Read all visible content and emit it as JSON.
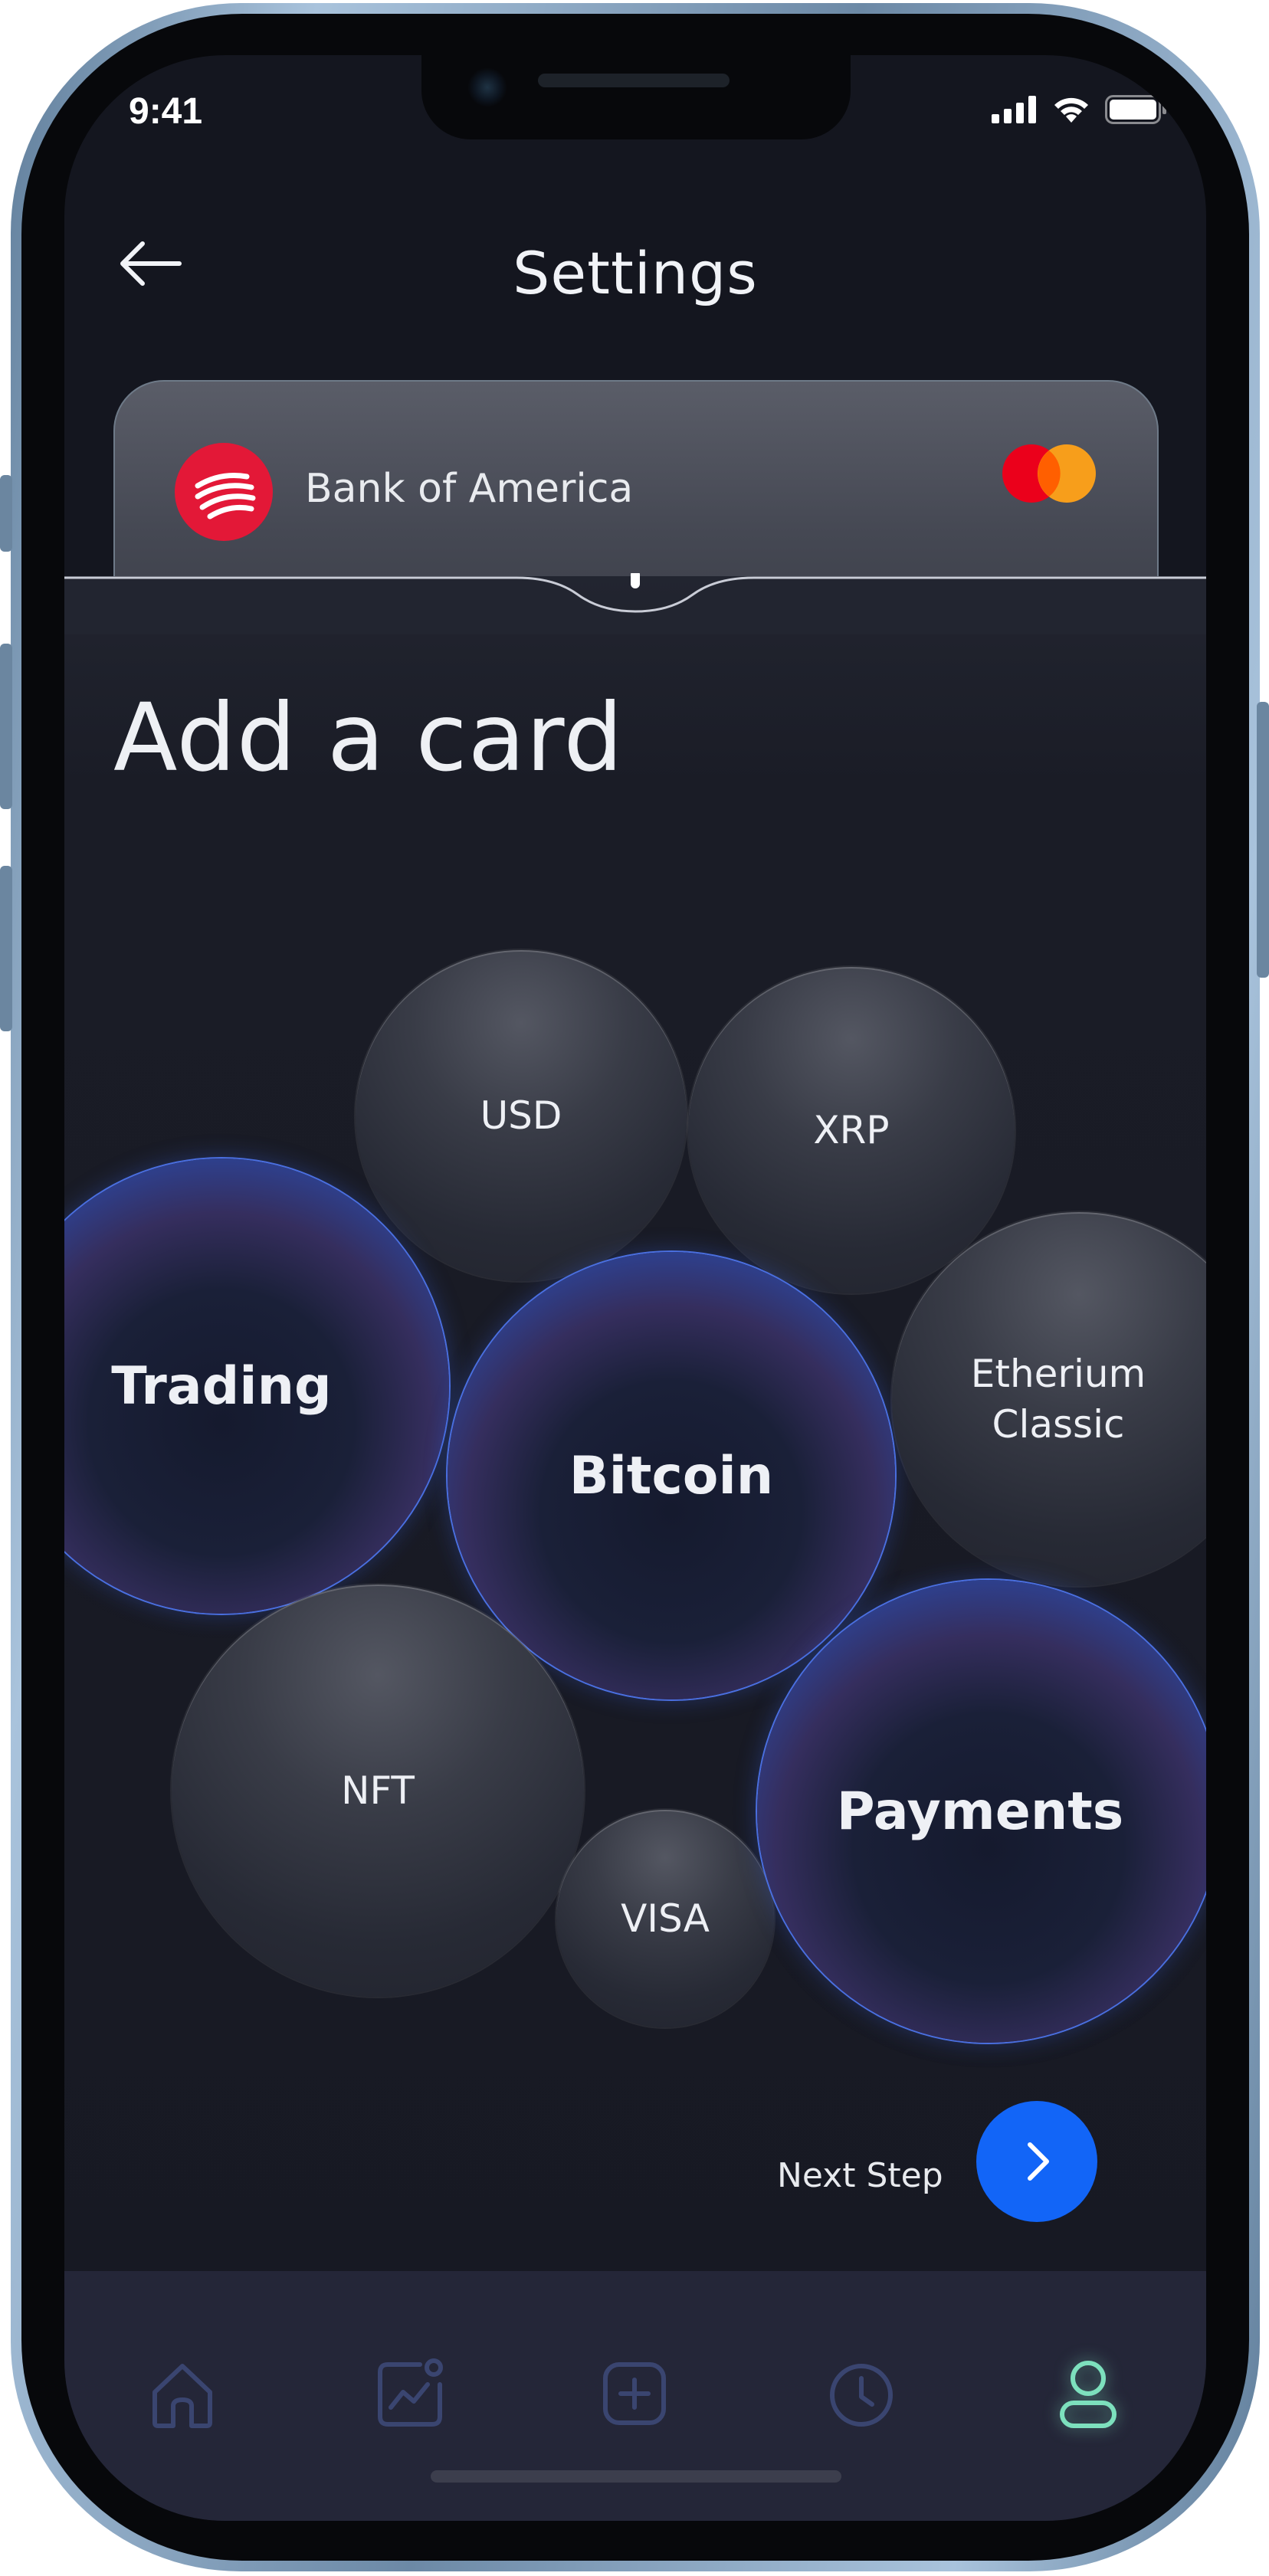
{
  "status": {
    "time": "9:41"
  },
  "header": {
    "title": "Settings"
  },
  "card": {
    "bank_name": "Bank of America"
  },
  "main": {
    "title": "Add a card",
    "bubbles": {
      "usd": "USD",
      "xrp": "XRP",
      "trading": "Trading",
      "bitcoin": "Bitcoin",
      "etherium_line1": "Etherium",
      "etherium_line2": "Classic",
      "nft": "NFT",
      "visa": "VISA",
      "payments": "Payments"
    },
    "next_step": "Next Step"
  },
  "nav": {
    "items": [
      "home-icon",
      "chart-icon",
      "add-icon",
      "history-icon",
      "profile-icon"
    ],
    "active": "profile-icon",
    "active_color": "#7de0bd",
    "inactive_color": "#3a4570"
  },
  "colors": {
    "background": "#14161f",
    "accent_blue": "#1265f7",
    "bank_red": "#e31837"
  }
}
